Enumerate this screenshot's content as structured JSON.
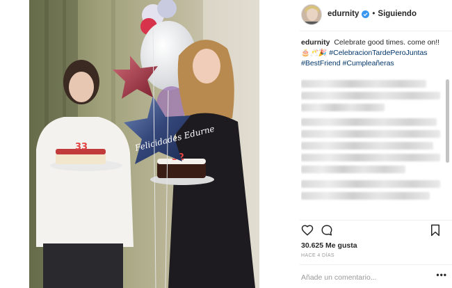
{
  "post": {
    "username": "edurnity",
    "separator": "•",
    "follow_label": "Siguiendo"
  },
  "caption": {
    "username": "edurnity",
    "text": "Celebrate good times. come on!!",
    "emoji": "🎂🥂🎉",
    "hashtags": [
      "#CelebracionTardePeroJuntas",
      "#BestFriend",
      "#Cumpleañeras"
    ]
  },
  "photo": {
    "balloon_text": "Felicidades Edurne",
    "left_cake_number": "33",
    "right_cake_number": "32"
  },
  "stats": {
    "likes": "30.625 Me gusta",
    "timestamp": "HACE 4 DÍAS"
  },
  "comment": {
    "placeholder": "Añade un comentario...",
    "more_label": "•••"
  },
  "icons": {
    "like": "heart-icon",
    "comment": "comment-icon",
    "save": "bookmark-icon",
    "verified": "verified-badge-icon",
    "options": "more-options-icon"
  },
  "colors": {
    "verified": "#3897f0",
    "hashtag": "#003569",
    "muted": "#999999",
    "divider": "#efefef"
  }
}
